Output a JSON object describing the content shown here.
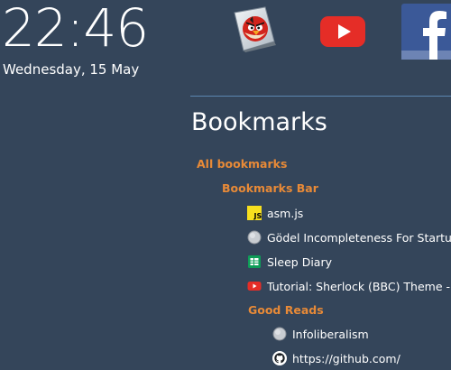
{
  "clock": {
    "time": "22:46",
    "date": "Wednesday, 15 May"
  },
  "apps": [
    {
      "name": "Angry Birds",
      "icon": "angry-birds-icon"
    },
    {
      "name": "YouTube",
      "icon": "youtube-icon"
    },
    {
      "name": "Facebook",
      "icon": "facebook-icon"
    }
  ],
  "bookmarks": {
    "title": "Bookmarks",
    "items": [
      {
        "label": "All bookmarks",
        "type": "folder",
        "level": 0
      },
      {
        "label": "Bookmarks Bar",
        "type": "folder",
        "level": 1
      },
      {
        "label": "asm.js",
        "type": "link",
        "level": 2,
        "icon": "js-icon"
      },
      {
        "label": "Gödel Incompleteness For Startups",
        "type": "link",
        "level": 2,
        "icon": "globe-icon"
      },
      {
        "label": "Sleep Diary",
        "type": "link",
        "level": 2,
        "icon": "sheets-icon"
      },
      {
        "label": "Tutorial: Sherlock (BBC) Theme - Fi",
        "type": "link",
        "level": 2,
        "icon": "youtube-icon"
      },
      {
        "label": "Good Reads",
        "type": "folder",
        "level": 2
      },
      {
        "label": "Infoliberalism",
        "type": "link",
        "level": 3,
        "icon": "globe-icon"
      },
      {
        "label": "https://github.com/",
        "type": "link",
        "level": 3,
        "icon": "github-icon"
      }
    ]
  },
  "colors": {
    "background": "#34455a",
    "folder": "#e88a37",
    "divider": "#5b86b0"
  }
}
